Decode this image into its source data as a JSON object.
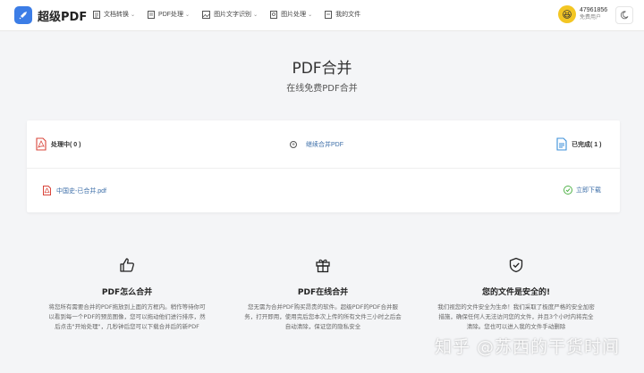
{
  "brand": {
    "name": "超级PDF",
    "accent": "#3c7de6"
  },
  "nav": [
    {
      "label": "文档转换",
      "icon": "document-convert-icon",
      "dropdown": true
    },
    {
      "label": "PDF处理",
      "icon": "pdf-process-icon",
      "dropdown": true
    },
    {
      "label": "图片文字识别",
      "icon": "image-ocr-icon",
      "dropdown": true
    },
    {
      "label": "图片处理",
      "icon": "image-process-icon",
      "dropdown": true
    },
    {
      "label": "我的文件",
      "icon": "my-files-icon",
      "dropdown": false
    }
  ],
  "user": {
    "id": "47961856",
    "role": "免费用户"
  },
  "page": {
    "title": "PDF合并",
    "subtitle": "在线免费PDF合并"
  },
  "card": {
    "processing_label": "处理中( 0 )",
    "continue_label": "继续合并PDF",
    "done_label": "已完成( 1 )",
    "file_name": "中国史-已合并.pdf",
    "download_label": "立即下载"
  },
  "features": [
    {
      "icon": "thumbs-up-icon",
      "title": "PDF怎么合并",
      "desc": "将您所有需要合并的PDF拖放到上面的方框内。稍作等待你可以看到每一个PDF的预览图像，您可以拖动他们进行排序，然后点击\"开始处理\"，几秒钟后您可以下载合并后的新PDF"
    },
    {
      "icon": "gift-icon",
      "title": "PDF在线合并",
      "desc": "您无需为合并PDF购买昂贵的软件。超级PDF的PDF合并服务，打开即用，使用完后您本次上传的所有文件三小时之后会自动清除，保证您的隐私安全"
    },
    {
      "icon": "shield-check-icon",
      "title": "您的文件是安全的!",
      "desc": "我们视您的文件安全为生命！我们采取了极度严格的安全加密措施，确保任何人无法访问您的文件，并且3个小时内将完全清除。您也可以进入我的文件手动删除"
    }
  ],
  "watermark": "知乎 @苏西的干货时间"
}
